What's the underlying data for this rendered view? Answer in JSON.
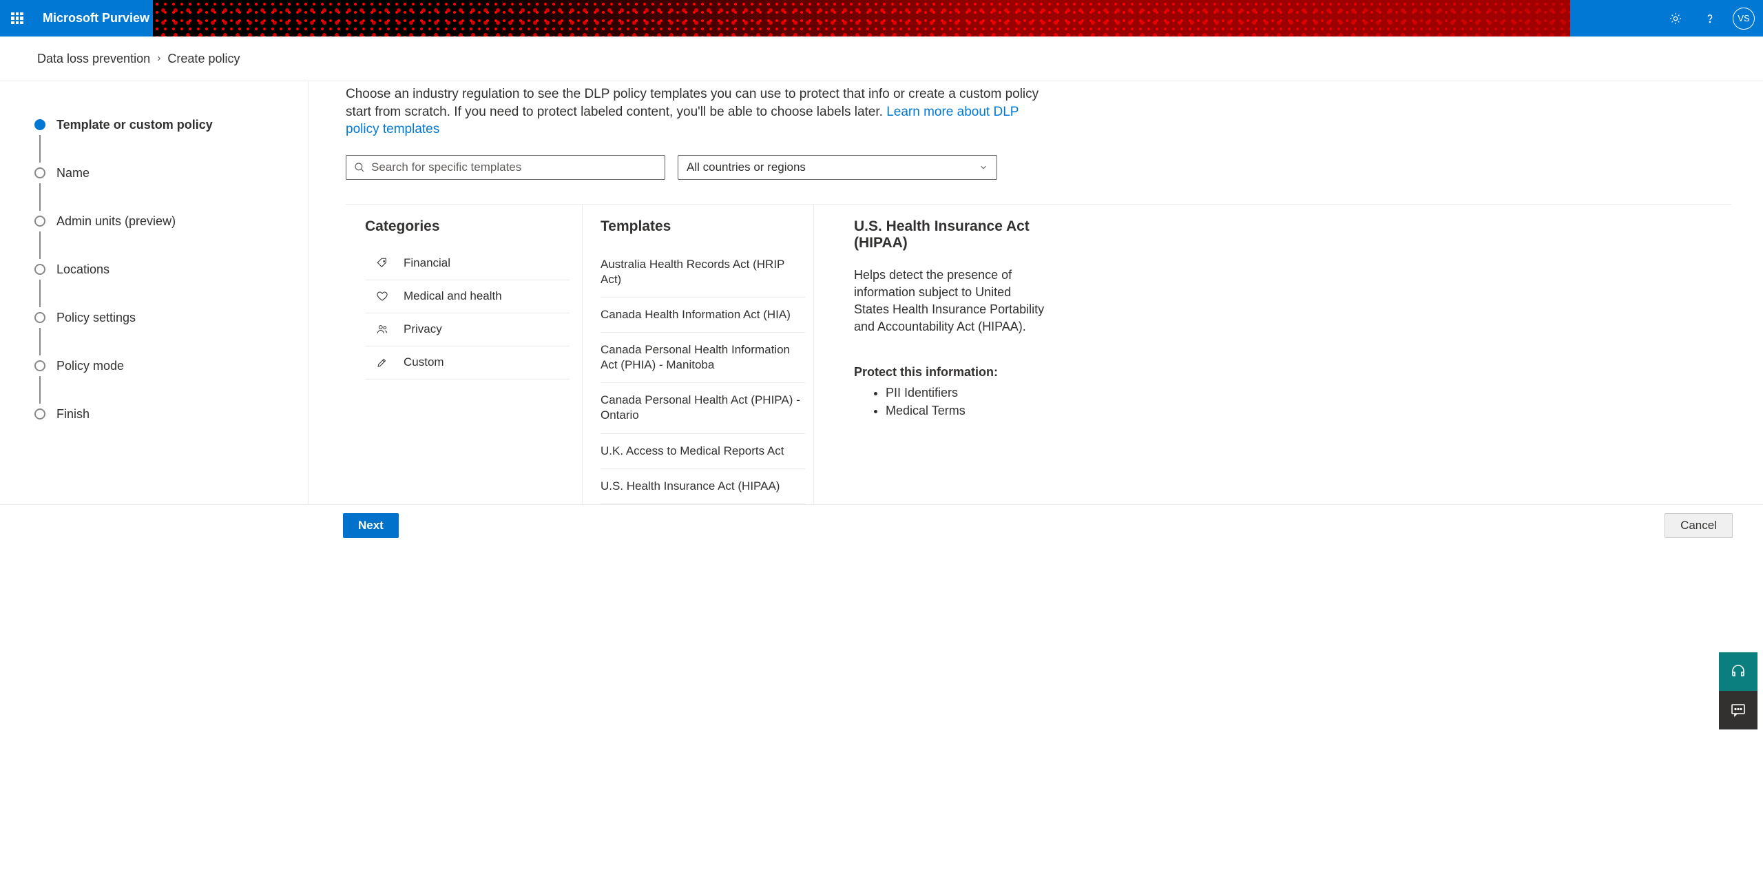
{
  "header": {
    "brand": "Microsoft Purview",
    "avatar": "VS"
  },
  "breadcrumb": {
    "parent": "Data loss prevention",
    "current": "Create policy"
  },
  "steps": [
    {
      "label": "Template or custom policy",
      "active": true
    },
    {
      "label": "Name",
      "active": false
    },
    {
      "label": "Admin units (preview)",
      "active": false
    },
    {
      "label": "Locations",
      "active": false
    },
    {
      "label": "Policy settings",
      "active": false
    },
    {
      "label": "Policy mode",
      "active": false
    },
    {
      "label": "Finish",
      "active": false
    }
  ],
  "intro": {
    "text": "Choose an industry regulation to see the DLP policy templates you can use to protect that info or create a custom policy start from scratch. If you need to protect labeled content, you'll be able to choose labels later. ",
    "link": "Learn more about DLP policy templates"
  },
  "search": {
    "placeholder": "Search for specific templates"
  },
  "region_filter": {
    "selected": "All countries or regions"
  },
  "columns": {
    "categories_title": "Categories",
    "templates_title": "Templates"
  },
  "categories": [
    {
      "label": "Financial",
      "icon": "tag"
    },
    {
      "label": "Medical and health",
      "icon": "heart"
    },
    {
      "label": "Privacy",
      "icon": "people"
    },
    {
      "label": "Custom",
      "icon": "pencil"
    }
  ],
  "templates": [
    {
      "label": "Australia Health Records Act (HRIP Act)"
    },
    {
      "label": "Canada Health Information Act (HIA)"
    },
    {
      "label": "Canada Personal Health Information Act (PHIA) - Manitoba"
    },
    {
      "label": "Canada Personal Health Act (PHIPA) - Ontario"
    },
    {
      "label": "U.K. Access to Medical Reports Act"
    },
    {
      "label": "U.S. Health Insurance Act (HIPAA)"
    }
  ],
  "details": {
    "title": "U.S. Health Insurance Act (HIPAA)",
    "description": "Helps detect the presence of information subject to United States Health Insurance Portability and Accountability Act (HIPAA).",
    "protect_heading": "Protect this information:",
    "protect_items": [
      "PII Identifiers",
      "Medical Terms"
    ]
  },
  "footer": {
    "next": "Next",
    "cancel": "Cancel"
  }
}
